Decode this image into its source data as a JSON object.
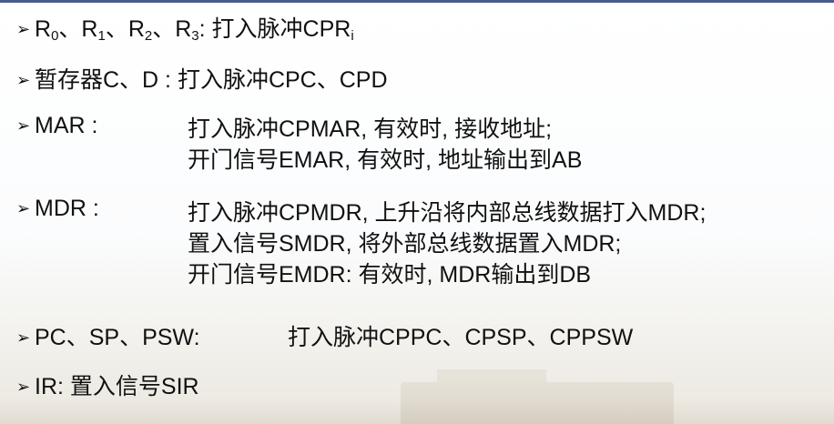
{
  "items": {
    "regs": {
      "r0": "R",
      "r0_sub": "0",
      "sep1": "、R",
      "r1_sub": "1",
      "sep2": "、R",
      "r2_sub": "2",
      "sep3": "、R",
      "r3_sub": "3",
      "desc": ": 打入脉冲CPR",
      "desc_sub": "i"
    },
    "temp": {
      "label": "暂存器C、D : 打入脉冲CPC、CPD"
    },
    "mar": {
      "label": "MAR :",
      "lines": [
        "打入脉冲CPMAR, 有效时, 接收地址;",
        "开门信号EMAR, 有效时, 地址输出到AB"
      ]
    },
    "mdr": {
      "label": "MDR :",
      "lines": [
        "打入脉冲CPMDR, 上升沿将内部总线数据打入MDR;",
        "置入信号SMDR, 将外部总线数据置入MDR;",
        "开门信号EMDR: 有效时, MDR输出到DB"
      ]
    },
    "pc": {
      "label": "PC、SP、PSW:",
      "desc": "打入脉冲CPPC、CPSP、CPPSW"
    },
    "ir": {
      "label": "IR: 置入信号SIR"
    }
  },
  "bullet_glyph": "➢"
}
